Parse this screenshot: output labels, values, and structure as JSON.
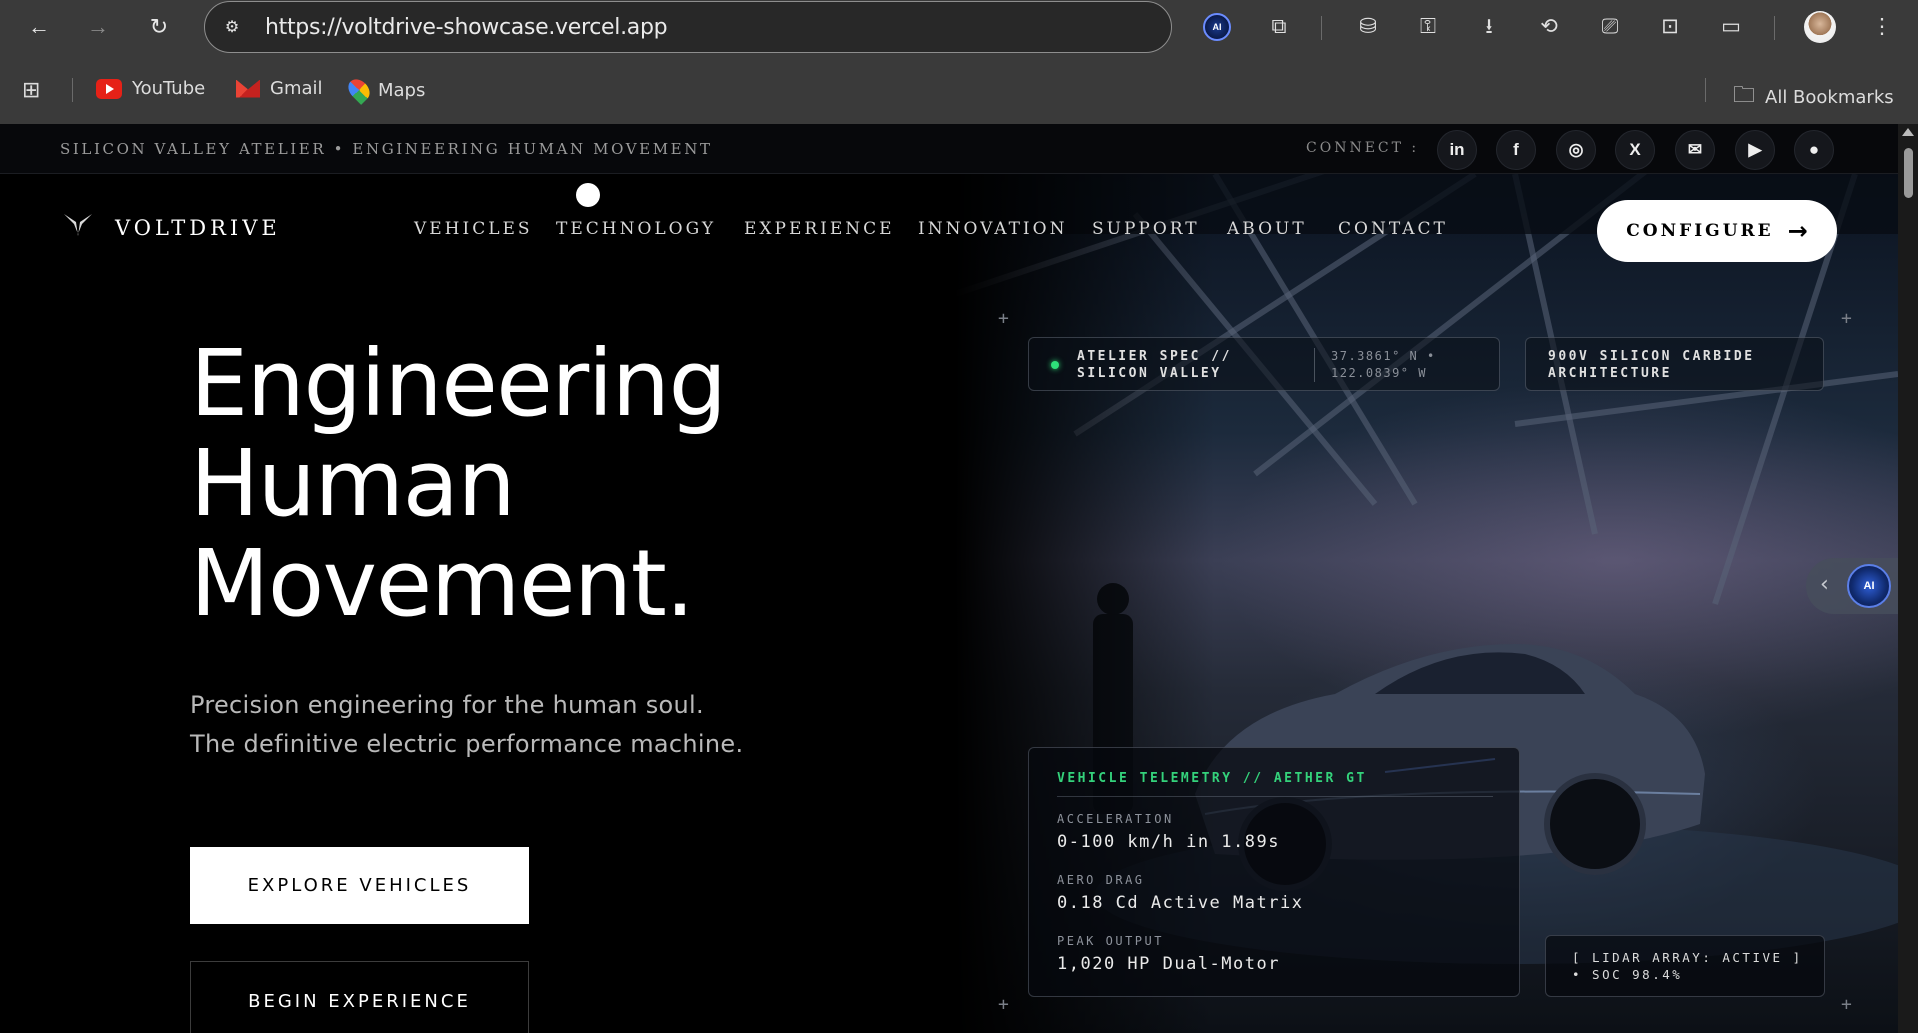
{
  "browser": {
    "url": "https://voltdrive-showcase.vercel.app",
    "nav": {
      "back_icon": "←",
      "forward_icon": "→",
      "reload_icon": "↻"
    },
    "ai_extension_label": "AI",
    "bookmarks": [
      {
        "label": "YouTube"
      },
      {
        "label": "Gmail"
      },
      {
        "label": "Maps"
      }
    ],
    "all_bookmarks": "All Bookmarks"
  },
  "topstrip": {
    "tagline": "SILICON VALLEY ATELIER • ENGINEERING HUMAN MOVEMENT",
    "connect_label": "CONNECT :",
    "socials": [
      {
        "name": "linkedin",
        "glyph": "in"
      },
      {
        "name": "facebook",
        "glyph": "f"
      },
      {
        "name": "instagram",
        "glyph": "◎"
      },
      {
        "name": "x",
        "glyph": "X"
      },
      {
        "name": "email",
        "glyph": "✉"
      },
      {
        "name": "youtube",
        "glyph": "▶"
      },
      {
        "name": "github",
        "glyph": "●"
      }
    ]
  },
  "nav": {
    "brand": "VOLTDRIVE",
    "links": [
      "VEHICLES",
      "TECHNOLOGY",
      "EXPERIENCE",
      "INNOVATION",
      "SUPPORT",
      "ABOUT",
      "CONTACT"
    ],
    "cta": "CONFIGURE",
    "cta_arrow": "→"
  },
  "hero": {
    "headline": [
      "Engineering",
      "Human",
      "Movement."
    ],
    "subline": [
      "Precision engineering for the human soul.",
      "The definitive electric performance machine."
    ],
    "primary_button": "EXPLORE VEHICLES",
    "secondary_button": "BEGIN EXPERIENCE"
  },
  "specs": {
    "atelier": "ATELIER SPEC // SILICON VALLEY",
    "coords": "37.3861° N • 122.0839° W",
    "architecture": "900V SILICON CARBIDE ARCHITECTURE",
    "status_color": "#2ee07a"
  },
  "telemetry": {
    "title": "VEHICLE TELEMETRY // AETHER GT",
    "title_color": "#34d27b",
    "rows": [
      {
        "label": "ACCELERATION",
        "value": "0-100 km/h in 1.89s"
      },
      {
        "label": "AERO DRAG",
        "value": "0.18 Cd Active Matrix"
      },
      {
        "label": "PEAK OUTPUT",
        "value": "1,020 HP Dual-Motor"
      }
    ],
    "lidar": "[ LIDAR ARRAY: ACTIVE ] • SOC 98.4%"
  },
  "ai_widget": {
    "label": "AI",
    "chevron": "‹"
  }
}
